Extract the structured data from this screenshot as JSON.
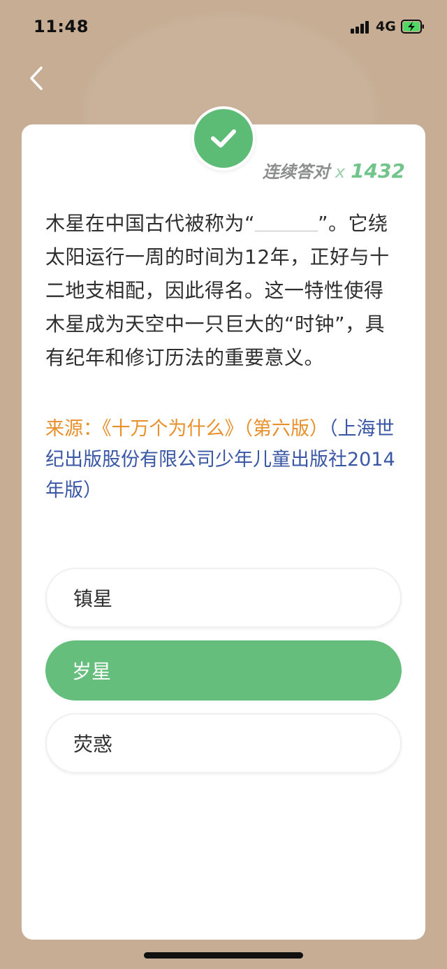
{
  "status_bar": {
    "time": "11:48",
    "network": "4G",
    "icons": [
      "signal-icon",
      "battery-charging-icon"
    ]
  },
  "nav": {
    "back_icon": "chevron-left-icon"
  },
  "result": {
    "icon": "check-icon",
    "streak_label": "连续答对",
    "streak_x": "x",
    "streak_count": "1432"
  },
  "question": {
    "before_blank": "木星在中国古代被称为“",
    "after_blank": "”。它绕太阳运行一周的时间为12年，正好与十二地支相配，因此得名。这一特性使得木星成为天空中一只巨大的“时钟”，具有纪年和修订历法的重要意义。"
  },
  "source": {
    "label": "来源：《十万个为什么》（第六版）",
    "publisher": "（上海世纪出版股份有限公司少年儿童出版社2014年版）"
  },
  "options": [
    {
      "label": "镇星",
      "state": "default"
    },
    {
      "label": "岁星",
      "state": "correct"
    },
    {
      "label": "荧惑",
      "state": "default"
    }
  ],
  "colors": {
    "background": "#C6AD93",
    "correct_green": "#66BE7C",
    "source_orange": "#E8902C",
    "source_blue": "#3A57A6"
  }
}
